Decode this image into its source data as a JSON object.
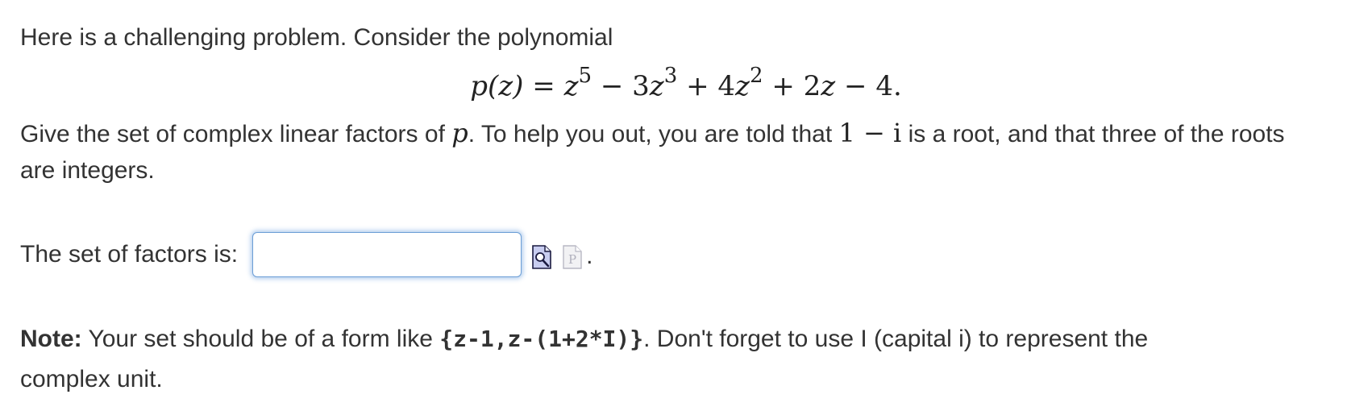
{
  "problem": {
    "intro": "Here is a challenging problem. Consider the polynomial",
    "equation": {
      "lhs": "p(z)",
      "equals": "=",
      "terms": [
        {
          "var": "z",
          "exp": "5"
        },
        {
          "op": "−",
          "coef": "3",
          "var": "z",
          "exp": "3"
        },
        {
          "op": "+",
          "coef": "4",
          "var": "z",
          "exp": "2"
        },
        {
          "op": "+",
          "coef": "2",
          "var": "z"
        },
        {
          "op": "−",
          "const": "4."
        }
      ]
    },
    "task_part1": "Give the set of complex linear factors of ",
    "task_var": "p",
    "task_part2": ". To help you out, you are told that ",
    "task_root": "1 − i",
    "task_part3": " is a root, and that three of the roots",
    "task_line2": "are integers."
  },
  "answer": {
    "label": "The set of factors is:",
    "value": "",
    "placeholder": "",
    "preview_icon": "preview-icon",
    "equation_editor_icon": "equation-editor-icon",
    "trailing": "."
  },
  "note": {
    "bold": "Note:",
    "text_before": " Your set should be of a form like ",
    "example": "{z-1,z-(1+2*I)}",
    "text_after": ". Don't forget to use I (capital i) to represent the",
    "line2": "complex unit."
  }
}
